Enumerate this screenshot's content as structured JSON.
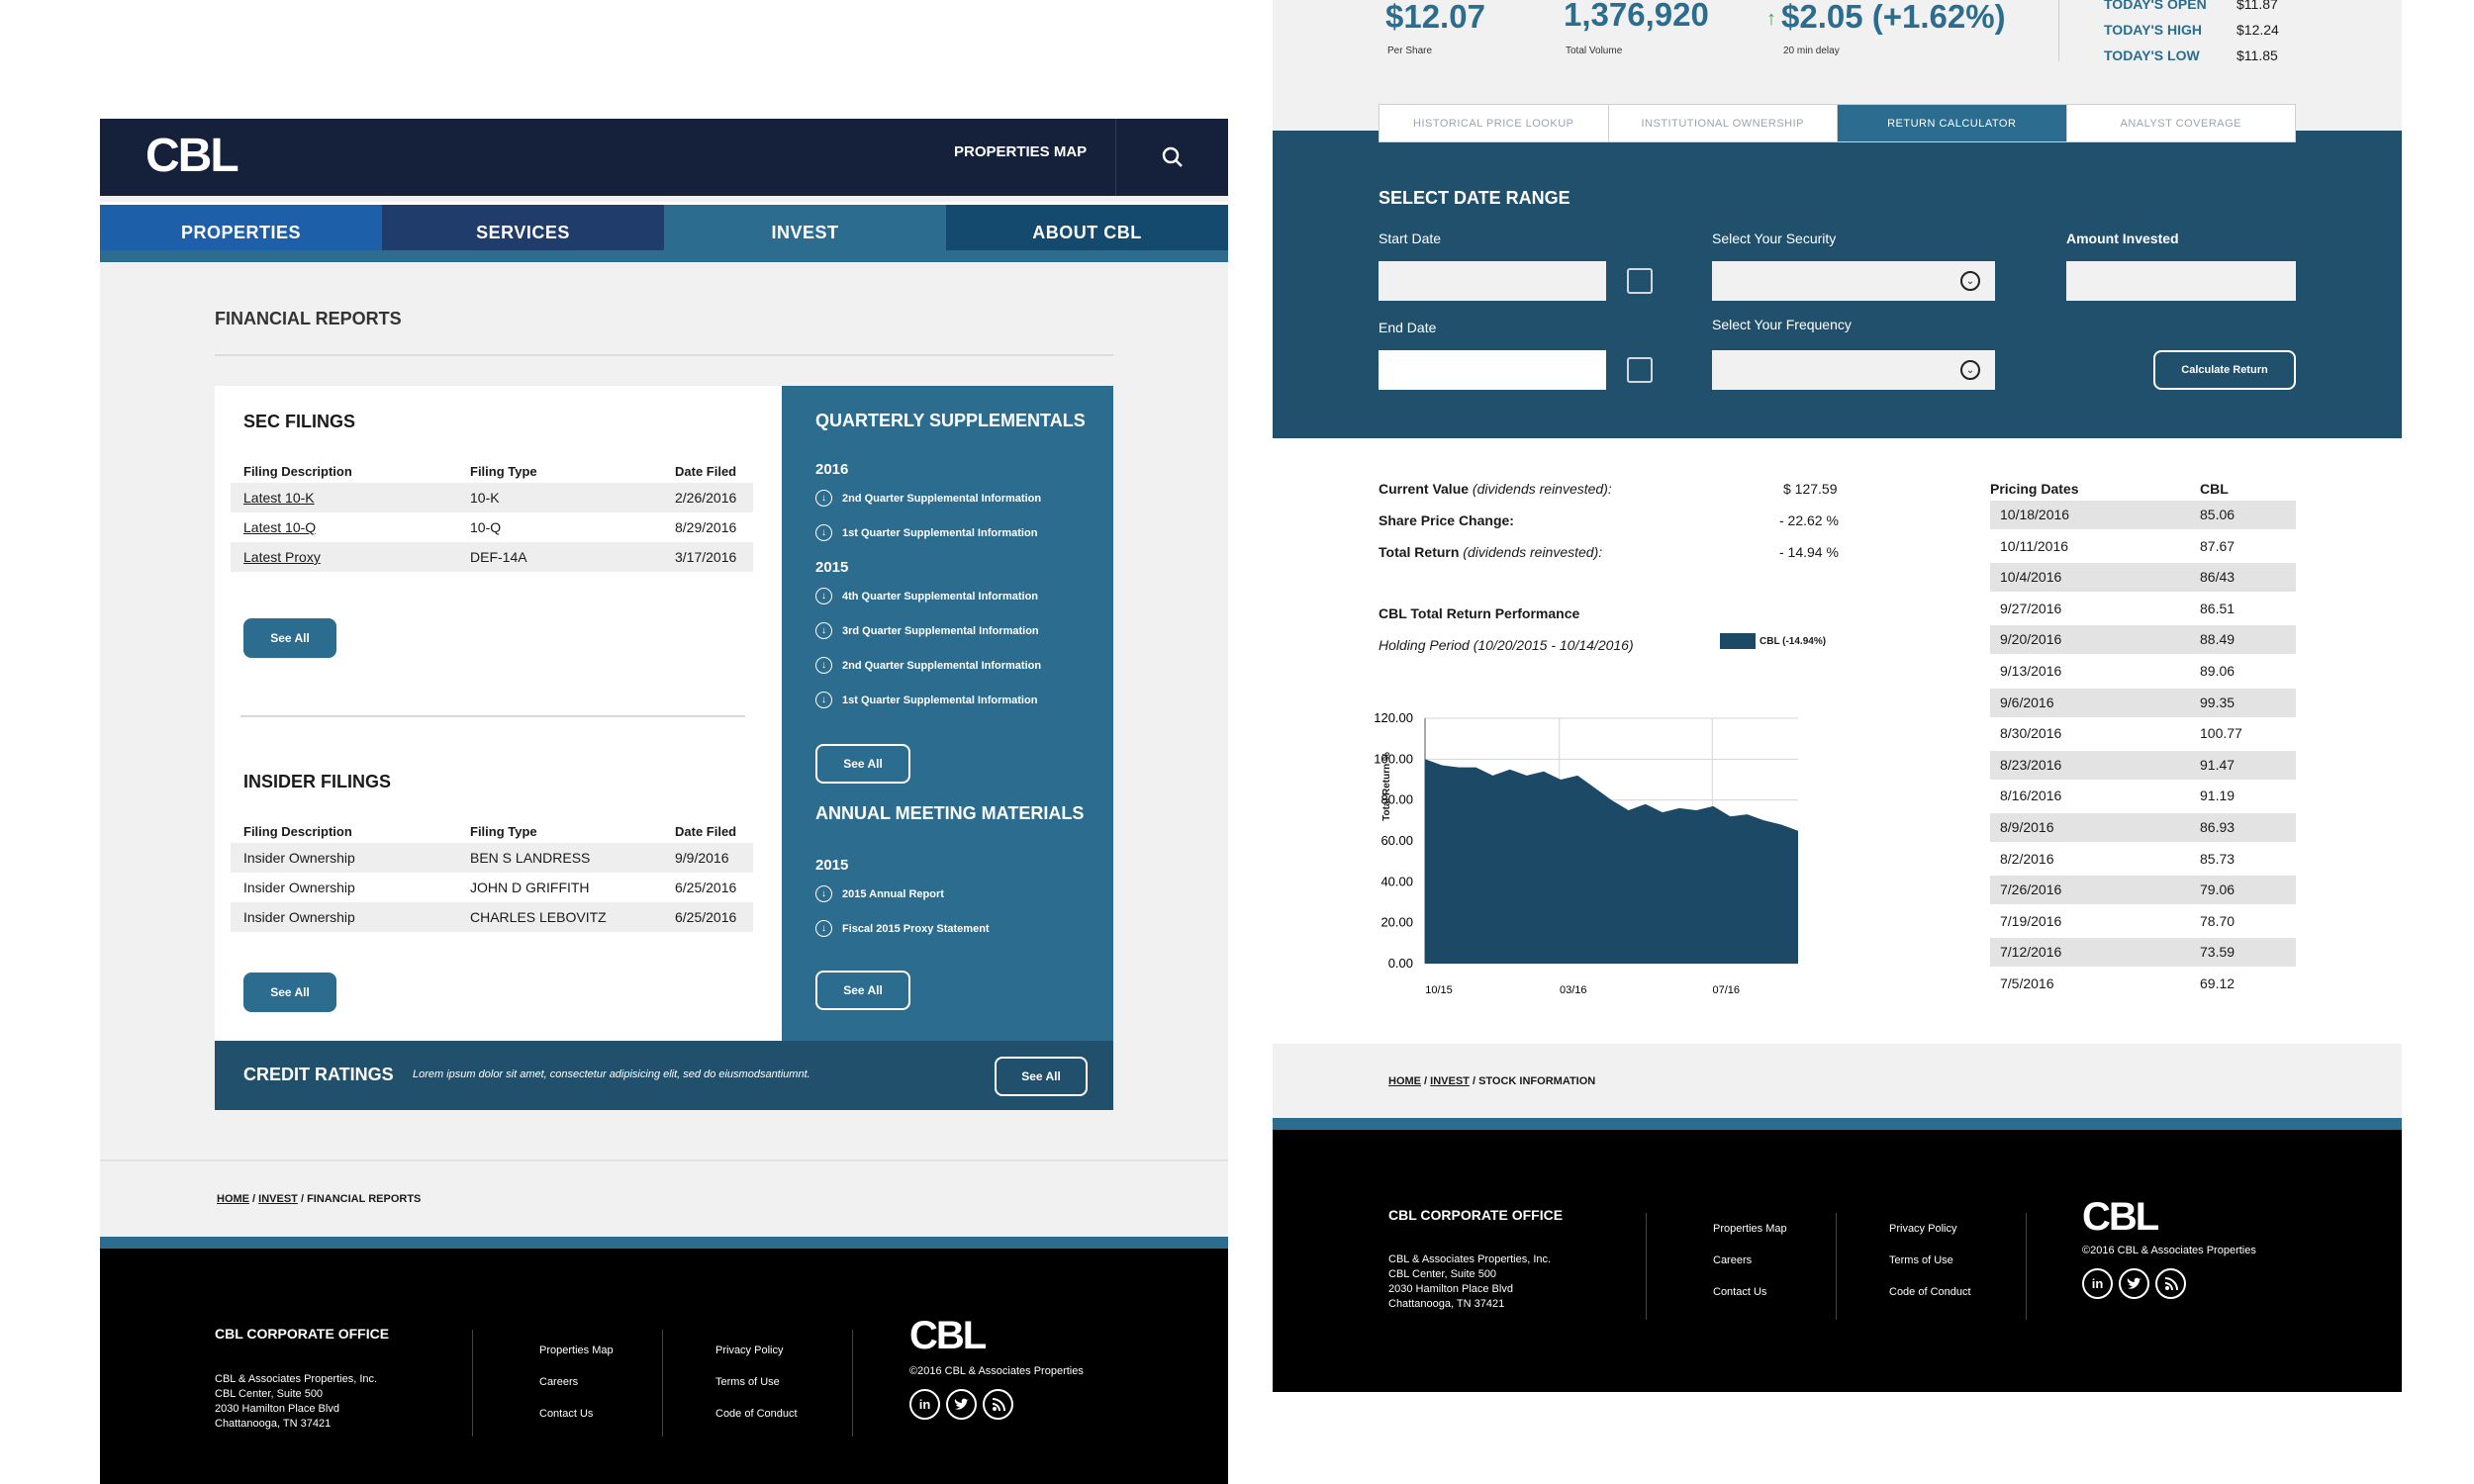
{
  "left_page": {
    "logo": "CBL",
    "header_link": "PROPERTIES MAP",
    "nav": [
      "PROPERTIES",
      "SERVICES",
      "INVEST",
      "ABOUT CBL"
    ],
    "page_title": "FINANCIAL REPORTS",
    "sec_filings": {
      "title": "SEC FILINGS",
      "headers": [
        "Filing Description",
        "Filing Type",
        "Date Filed"
      ],
      "rows": [
        [
          "Latest 10-K",
          "10-K",
          "2/26/2016"
        ],
        [
          "Latest 10-Q",
          "10-Q",
          "8/29/2016"
        ],
        [
          "Latest Proxy",
          "DEF-14A",
          "3/17/2016"
        ]
      ],
      "button": "See All"
    },
    "insider_filings": {
      "title": "INSIDER FILINGS",
      "headers": [
        "Filing Description",
        "Filing Type",
        "Date Filed"
      ],
      "rows": [
        [
          "Insider Ownership",
          "BEN S LANDRESS",
          "9/9/2016"
        ],
        [
          "Insider Ownership",
          "JOHN D GRIFFITH",
          "6/25/2016"
        ],
        [
          "Insider Ownership",
          "CHARLES LEBOVITZ",
          "6/25/2016"
        ]
      ],
      "button": "See All"
    },
    "quarterly": {
      "title": "QUARTERLY SUPPLEMENTALS",
      "year1": "2016",
      "items1": [
        "2nd Quarter Supplemental Information",
        "1st Quarter Supplemental Information"
      ],
      "year2": "2015",
      "items2": [
        "4th Quarter Supplemental Information",
        "3rd Quarter Supplemental Information",
        "2nd Quarter Supplemental Information",
        "1st Quarter Supplemental Information"
      ],
      "button": "See All"
    },
    "annual": {
      "title": "ANNUAL MEETING MATERIALS",
      "year": "2015",
      "items": [
        "2015 Annual Report",
        "Fiscal 2015 Proxy Statement"
      ],
      "button": "See All"
    },
    "credit": {
      "title": "CREDIT RATINGS",
      "text": "Lorem ipsum dolor sit amet, consectetur adipisicing elit, sed do eiusmodsantiumnt.",
      "button": "See All"
    },
    "breadcrumb": {
      "home": "HOME",
      "invest": "INVEST",
      "current": "FINANCIAL REPORTS"
    }
  },
  "footer": {
    "office_title": "CBL CORPORATE OFFICE",
    "address": [
      "CBL & Associates Properties, Inc.",
      "CBL Center, Suite 500",
      "2030 Hamilton Place Blvd",
      "Chattanooga, TN 37421"
    ],
    "links_col1": [
      "Properties Map",
      "Careers",
      "Contact Us"
    ],
    "links_col2": [
      "Privacy Policy",
      "Terms of Use",
      "Code of Conduct"
    ],
    "logo": "CBL",
    "copyright": "©2016 CBL & Associates Properties",
    "social_icons": [
      "linkedin-icon",
      "twitter-icon",
      "rss-icon"
    ]
  },
  "right_page": {
    "stats": {
      "price": "$12.07",
      "price_label": "Per Share",
      "volume": "1,376,920",
      "volume_label": "Total Volume",
      "change": "$2.05 (+1.62%)",
      "change_label": "20 min delay",
      "today_open_label": "TODAY'S OPEN",
      "today_open": "$11.87",
      "today_high_label": "TODAY'S HIGH",
      "today_high": "$12.24",
      "today_low_label": "TODAY'S LOW",
      "today_low": "$11.85"
    },
    "tabs": [
      "HISTORICAL PRICE LOOKUP",
      "INSTITUTIONAL OWNERSHIP",
      "RETURN CALCULATOR",
      "ANALYST COVERAGE"
    ],
    "active_tab": "RETURN CALCULATOR",
    "calc": {
      "title": "SELECT DATE RANGE",
      "start_label": "Start Date",
      "end_label": "End Date",
      "security_label": "Select Your Security",
      "frequency_label": "Select Your Frequency",
      "amount_label": "Amount Invested",
      "button": "Calculate Return"
    },
    "results": {
      "current_value_label": "Current Value",
      "current_value_note": "(dividends reinvested):",
      "current_value": "$ 127.59",
      "share_price_label": "Share Price Change:",
      "share_price": "- 22.62 %",
      "total_return_label": "Total Return",
      "total_return_note": "(dividends reinvested):",
      "total_return": "- 14.94 %",
      "perf_title": "CBL Total Return Performance",
      "holding_period": "Holding Period (10/20/2015 - 10/14/2016)",
      "legend": "CBL (-14.94%)"
    },
    "pricing": {
      "headers": [
        "Pricing Dates",
        "CBL"
      ],
      "rows": [
        [
          "10/18/2016",
          "85.06"
        ],
        [
          "10/11/2016",
          "87.67"
        ],
        [
          "10/4/2016",
          "86/43"
        ],
        [
          "9/27/2016",
          "86.51"
        ],
        [
          "9/20/2016",
          "88.49"
        ],
        [
          "9/13/2016",
          "89.06"
        ],
        [
          "9/6/2016",
          "99.35"
        ],
        [
          "8/30/2016",
          "100.77"
        ],
        [
          "8/23/2016",
          "91.47"
        ],
        [
          "8/16/2016",
          "91.19"
        ],
        [
          "8/9/2016",
          "86.93"
        ],
        [
          "8/2/2016",
          "85.73"
        ],
        [
          "7/26/2016",
          "79.06"
        ],
        [
          "7/19/2016",
          "78.70"
        ],
        [
          "7/12/2016",
          "73.59"
        ],
        [
          "7/5/2016",
          "69.12"
        ]
      ]
    },
    "breadcrumb": {
      "home": "HOME",
      "invest": "INVEST",
      "current": "STOCK INFORMATION"
    }
  },
  "chart_data": {
    "type": "area",
    "ylabel": "Total Return %",
    "ylim": [
      0,
      120
    ],
    "yticks": [
      "0.00",
      "20.00",
      "40.00",
      "60.00",
      "80.00",
      "100.00",
      "120.00"
    ],
    "xticks": [
      "10/15",
      "03/16",
      "07/16"
    ],
    "series": [
      {
        "name": "CBL (-14.94%)",
        "color": "#1c4a66",
        "values": [
          100,
          97,
          96,
          96,
          92,
          95,
          92,
          94,
          90,
          92,
          86,
          80,
          75,
          78,
          74,
          76,
          75,
          77,
          72,
          73,
          70,
          68,
          65
        ]
      }
    ]
  }
}
